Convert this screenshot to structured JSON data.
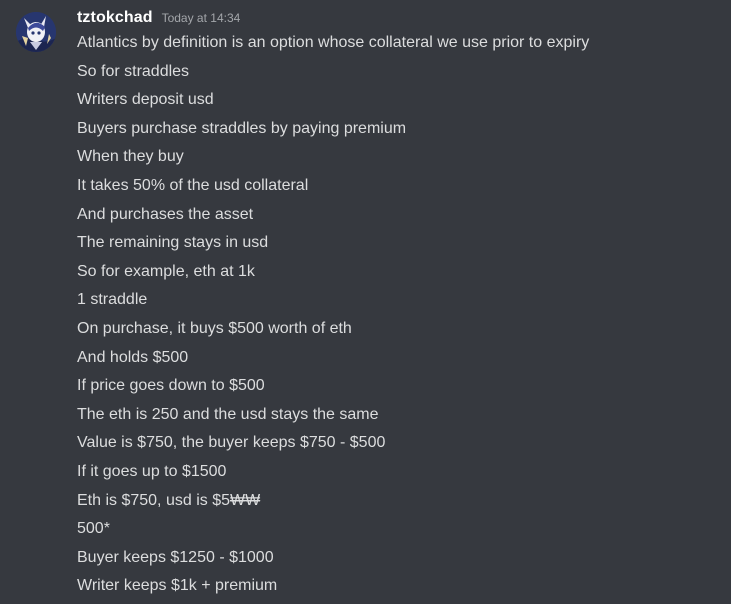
{
  "message": {
    "author": "tztokchad",
    "timestamp": "Today at 14:34",
    "avatar_icon": "anime-character-avatar-icon",
    "lines": [
      "Atlantics by definition is an option whose collateral we use prior to expiry",
      "So for straddles",
      "Writers deposit usd",
      "Buyers purchase straddles by paying premium",
      "When they buy",
      "It takes 50% of the usd collateral",
      "And purchases the asset",
      "The remaining stays in usd",
      "So for example, eth at 1k",
      "1 straddle",
      "On purchase, it buys $500 worth of eth",
      "And holds $500",
      "If price goes down to $500",
      "The eth is 250 and the usd stays the same",
      "Value is $750, the buyer keeps $750 - $500",
      "If it goes up to $1500",
      "Eth is $750, usd is $5",
      "500*",
      "Buyer keeps $1250 - $1000",
      "Writer keeps $1k + premium"
    ],
    "struck_suffix": "₩₩",
    "struck_line_index": 16
  },
  "colors": {
    "background": "#36393f",
    "username": "#ffffff",
    "timestamp": "#a3a6aa",
    "text": "#dcddde"
  }
}
